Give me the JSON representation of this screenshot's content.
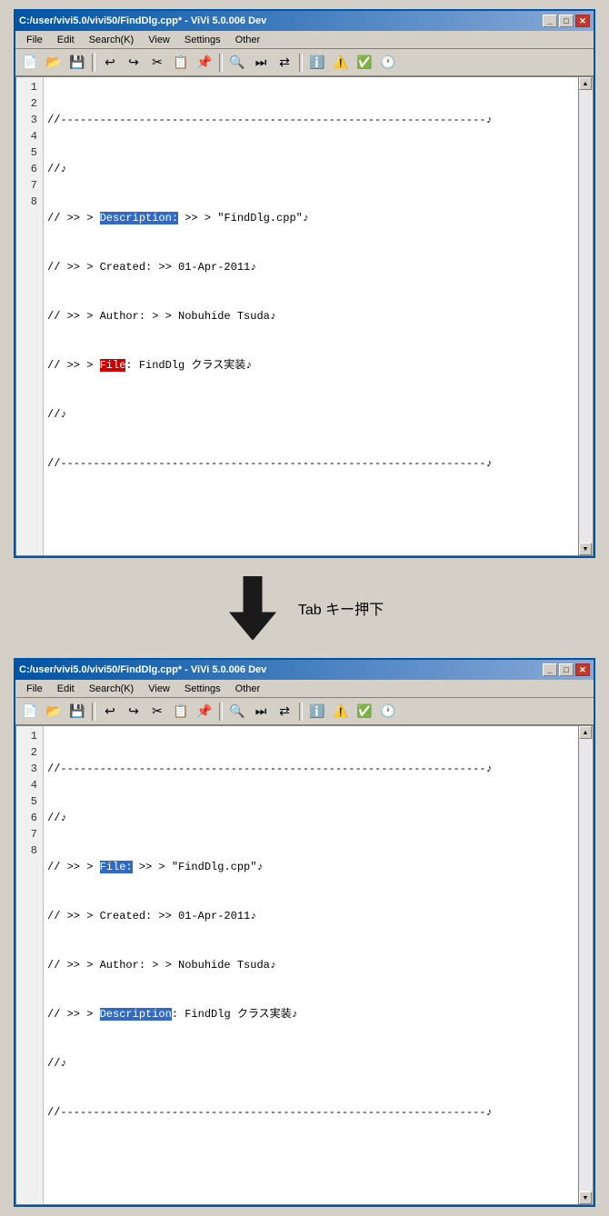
{
  "window1": {
    "title": "C:/user/vivi5.0/vivi50/FindDlg.cpp* - ViVi 5.0.006 Dev",
    "menu": [
      "File",
      "Edit",
      "Search(K)",
      "View",
      "Settings",
      "Other"
    ],
    "lines": [
      {
        "num": 1,
        "content": [
          {
            "t": "//-----------------------------------------------------------------",
            "cls": ""
          }
        ]
      },
      {
        "num": 2,
        "content": [
          {
            "t": "//♪",
            "cls": ""
          }
        ]
      },
      {
        "num": 3,
        "content": [
          {
            "t": "// >> > ",
            "cls": ""
          },
          {
            "t": "Description:",
            "cls": "hl-selected"
          },
          {
            "t": " >> > \"FindDlg.cpp\"♪",
            "cls": ""
          }
        ]
      },
      {
        "num": 4,
        "content": [
          {
            "t": "// >> > Created: >> 01-Apr-2011♪",
            "cls": ""
          }
        ]
      },
      {
        "num": 5,
        "content": [
          {
            "t": "// >> > Author: > > Nobuhide Tsuda♪",
            "cls": ""
          }
        ]
      },
      {
        "num": 6,
        "content": [
          {
            "t": "// >> > ",
            "cls": ""
          },
          {
            "t": "File",
            "cls": "hl-cursor-sel"
          },
          {
            "t": ": FindDlg クラス実装♪",
            "cls": ""
          }
        ]
      },
      {
        "num": 7,
        "content": [
          {
            "t": "//♪",
            "cls": ""
          }
        ]
      },
      {
        "num": 8,
        "content": [
          {
            "t": "//-----------------------------------------------------------------♪",
            "cls": ""
          }
        ]
      }
    ]
  },
  "arrow": {
    "label": "Tab キー押下"
  },
  "window2": {
    "title": "C:/user/vivi5.0/vivi50/FindDlg.cpp* - ViVi 5.0.006 Dev",
    "menu": [
      "File",
      "Edit",
      "Search(K)",
      "View",
      "Settings",
      "Other"
    ],
    "lines": [
      {
        "num": 1,
        "content": [
          {
            "t": "//-----------------------------------------------------------------",
            "cls": ""
          }
        ]
      },
      {
        "num": 2,
        "content": [
          {
            "t": "//♪",
            "cls": ""
          }
        ]
      },
      {
        "num": 3,
        "content": [
          {
            "t": "// >> > ",
            "cls": ""
          },
          {
            "t": "File:",
            "cls": "hl-selected"
          },
          {
            "t": " >> > \"FindDlg.cpp\"♪",
            "cls": ""
          }
        ]
      },
      {
        "num": 4,
        "content": [
          {
            "t": "// >> > Created: >> 01-Apr-2011♪",
            "cls": ""
          }
        ]
      },
      {
        "num": 5,
        "content": [
          {
            "t": "// >> > Author: > > Nobuhide Tsuda♪",
            "cls": ""
          }
        ]
      },
      {
        "num": 6,
        "content": [
          {
            "t": "// >> > ",
            "cls": ""
          },
          {
            "t": "Description",
            "cls": "hl-selected"
          },
          {
            "t": ": FindDlg クラス実装♪",
            "cls": ""
          }
        ]
      },
      {
        "num": 7,
        "content": [
          {
            "t": "//♪",
            "cls": ""
          }
        ]
      },
      {
        "num": 8,
        "content": [
          {
            "t": "//-----------------------------------------------------------------♪",
            "cls": ""
          }
        ]
      }
    ]
  },
  "toolbar_icons": [
    {
      "name": "new",
      "icon": "📄"
    },
    {
      "name": "open",
      "icon": "📂"
    },
    {
      "name": "save",
      "icon": "💾"
    },
    {
      "name": "undo",
      "icon": "↩"
    },
    {
      "name": "redo",
      "icon": "↪"
    },
    {
      "name": "cut",
      "icon": "✂"
    },
    {
      "name": "copy",
      "icon": "📋"
    },
    {
      "name": "paste",
      "icon": "📌"
    },
    {
      "name": "find",
      "icon": "🔍"
    },
    {
      "name": "find-next",
      "icon": "⏩"
    },
    {
      "name": "replace",
      "icon": "⇄"
    },
    {
      "name": "info",
      "icon": "ℹ"
    },
    {
      "name": "warn",
      "icon": "⚠"
    },
    {
      "name": "ok",
      "icon": "✅"
    },
    {
      "name": "clock",
      "icon": "🕐"
    }
  ]
}
